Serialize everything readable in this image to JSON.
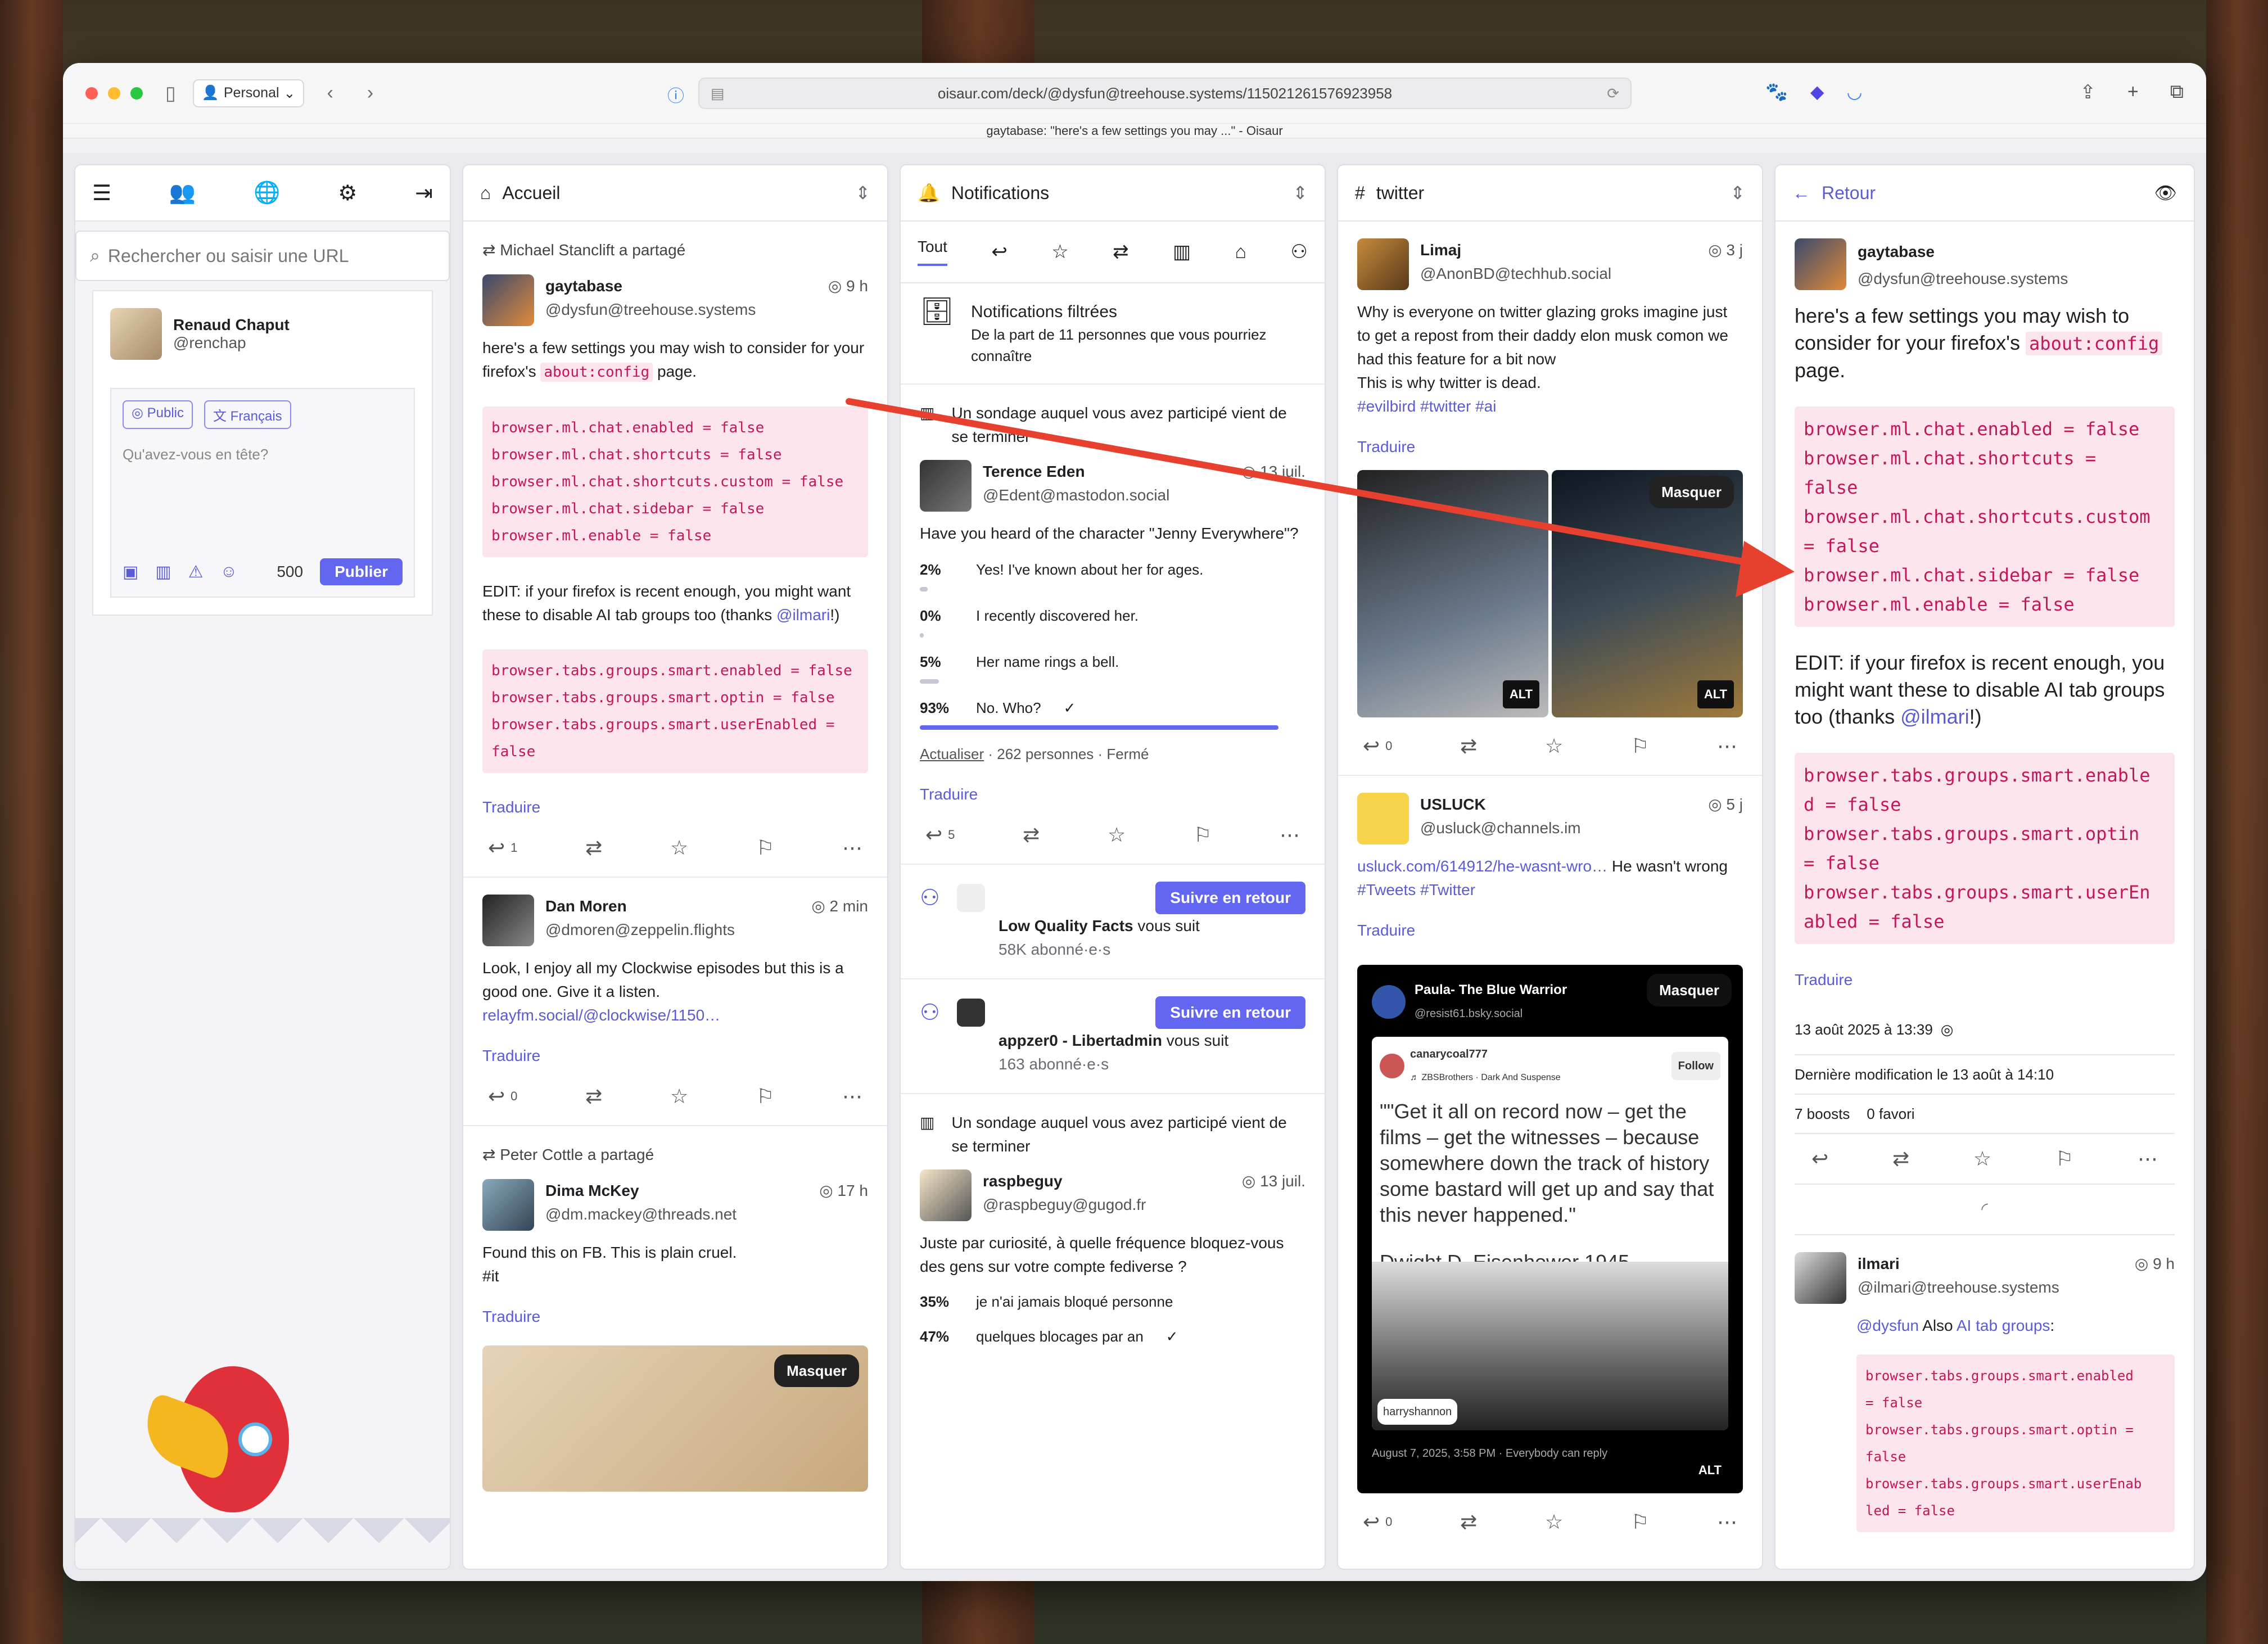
{
  "browser": {
    "profile": "Personal",
    "url": "oisaur.com/deck/@dysfun@treehouse.systems/115021261576923958",
    "tab_title": "gaytabase: \"here's a few settings you may ...\" - Oisaur",
    "light_colors": [
      "#ff5f57",
      "#febc2e",
      "#28c840"
    ]
  },
  "compose": {
    "search_placeholder": "Rechercher ou saisir une URL",
    "user_name": "Renaud Chaput",
    "user_handle": "@renchap",
    "visibility": "Public",
    "language": "Français",
    "placeholder": "Qu'avez-vous en tête?",
    "char_count": "500",
    "publish": "Publier"
  },
  "home": {
    "title": "Accueil",
    "post1": {
      "boost": "Michael Stanclift a partagé",
      "name": "gaytabase",
      "handle": "@dysfun@treehouse.systems",
      "time": "9 h",
      "text_a": "here's a few settings you may wish to consider for your firefox's ",
      "text_code": "about:config",
      "text_b": " page.",
      "code1": "browser.ml.chat.enabled = false\nbrowser.ml.chat.shortcuts = false\nbrowser.ml.chat.shortcuts.custom = false\nbrowser.ml.chat.sidebar = false\nbrowser.ml.enable = false",
      "edit_a": "EDIT: if your firefox is recent enough, you might want these to disable AI tab groups too (thanks ",
      "edit_mention": "@ilmari",
      "edit_b": "!)",
      "code2": "browser.tabs.groups.smart.enabled = false\nbrowser.tabs.groups.smart.optin = false\nbrowser.tabs.groups.smart.userEnabled =\nfalse",
      "translate": "Traduire",
      "replies": "1"
    },
    "post2": {
      "name": "Dan Moren",
      "handle": "@dmoren@zeppelin.flights",
      "time": "2 min",
      "text": "Look, I enjoy all my Clockwise episodes but this is a good one. Give it a listen.",
      "link": "relayfm.social/@clockwise/1150…",
      "translate": "Traduire",
      "replies": "0"
    },
    "post3": {
      "boost": "Peter Cottle a partagé",
      "name": "Dima McKey",
      "handle": "@dm.mackey@threads.net",
      "time": "17 h",
      "text": "Found this on FB. This is plain cruel.",
      "tag": "#it",
      "translate": "Traduire",
      "hide": "Masquer"
    }
  },
  "notifications": {
    "title": "Notifications",
    "filter_all": "Tout",
    "filtered_title": "Notifications filtrées",
    "filtered_sub": "De la part de 11 personnes que vous pourriez connaître",
    "poll_ended": "Un sondage auquel vous avez participé vient de se terminer",
    "n1": {
      "name": "Terence Eden",
      "handle": "@Edent@mastodon.social",
      "time": "13 juil.",
      "question": "Have you heard of the character \"Jenny Everywhere\"?",
      "options": [
        {
          "pct": "2%",
          "label": "Yes! I've known about her for ages.",
          "value": 2
        },
        {
          "pct": "0%",
          "label": "I recently discovered her.",
          "value": 0
        },
        {
          "pct": "5%",
          "label": "Her name rings a bell.",
          "value": 5
        },
        {
          "pct": "93%",
          "label": "No. Who?",
          "value": 93
        }
      ],
      "refresh": "Actualiser",
      "meta": " · 262 personnes · Fermé",
      "translate": "Traduire",
      "replies": "5"
    },
    "f1": {
      "follow_back": "Suivre en retour",
      "name": "Low Quality Facts",
      "suffix": " vous suit",
      "count": "58K abonné·e·s"
    },
    "f2": {
      "follow_back": "Suivre en retour",
      "name": "appzer0 - Libertadmin",
      "suffix": " vous suit",
      "count": "163 abonné·e·s"
    },
    "n2": {
      "name": "raspbeguy",
      "handle": "@raspbeguy@gugod.fr",
      "time": "13 juil.",
      "question": "Juste par curiosité, à quelle fréquence bloquez-vous des gens sur votre compte fediverse ?",
      "opt1_pct": "35%",
      "opt1": "je n'ai jamais bloqué personne",
      "opt2_pct": "47%",
      "opt2": "quelques blocages par an"
    }
  },
  "twitter": {
    "title": "twitter",
    "p1": {
      "name": "Limaj",
      "handle": "@AnonBD@techhub.social",
      "time": "3 j",
      "text": "Why is everyone on twitter glazing groks imagine just to get a repost from their daddy elon musk comon we had this feature for a bit now",
      "text2": "This is why twitter is dead.",
      "tags": "#evilbird #twitter #ai",
      "translate": "Traduire",
      "hide": "Masquer",
      "alt": "ALT",
      "replies": "0"
    },
    "p2": {
      "name": "USLUCK",
      "handle": "@usluck@channels.im",
      "time": "5 j",
      "link": "usluck.com/614912/he-wasnt-wro…",
      "text": " He wasn't wrong ",
      "tags": "#Tweets #Twitter",
      "translate": "Traduire",
      "hide": "Masquer",
      "card_name": "Paula- The Blue Warrior",
      "card_handle": "@resist61.bsky.social",
      "tweet_user": "canarycoal777",
      "tweet_music": "♬ ZBSBrothers · Dark And Suspense",
      "tweet_follow": "Follow",
      "quote": "\"\"Get it all on record now – get the films – get the witnesses – because somewhere down the track of history some bastard will get up and say that this never happened.\"",
      "quote_author": "Dwight D. Eisenhower 1945",
      "reposter": "harryshannon",
      "date": "August 7, 2025, 3:58 PM  ·  Everybody can reply",
      "alt": "ALT",
      "replies": "0"
    }
  },
  "thread": {
    "back": "Retour",
    "name": "gaytabase",
    "handle": "@dysfun@treehouse.systems",
    "text_a": "here's a few settings you may wish to consider for your firefox's ",
    "text_code": "about:config",
    "text_b": " page.",
    "code1": "browser.ml.chat.enabled = false\nbrowser.ml.chat.shortcuts =\nfalse\nbrowser.ml.chat.shortcuts.custom\n= false\nbrowser.ml.chat.sidebar = false\nbrowser.ml.enable = false",
    "edit_a": "EDIT: if your firefox is recent enough, you might want these to disable AI tab groups too (thanks ",
    "edit_mention": "@ilmari",
    "edit_b": "!)",
    "code2": "browser.tabs.groups.smart.enable\nd = false\nbrowser.tabs.groups.smart.optin\n= false\nbrowser.tabs.groups.smart.userEn\nabled = false",
    "translate": "Traduire",
    "date": "13 août 2025 à 13:39",
    "edited": "Dernière modification le 13 août à 14:10",
    "boosts": "7 boosts",
    "favs": "0 favori",
    "reply_name": "ilmari",
    "reply_handle": "@ilmari@treehouse.systems",
    "reply_time": "9 h",
    "reply_mention": "@dysfun",
    "reply_text": " Also ",
    "reply_link": "AI tab groups",
    "reply_colon": ":",
    "reply_code": "browser.tabs.groups.smart.enabled\n= false\nbrowser.tabs.groups.smart.optin =\nfalse\nbrowser.tabs.groups.smart.userEnab\nled = false"
  }
}
